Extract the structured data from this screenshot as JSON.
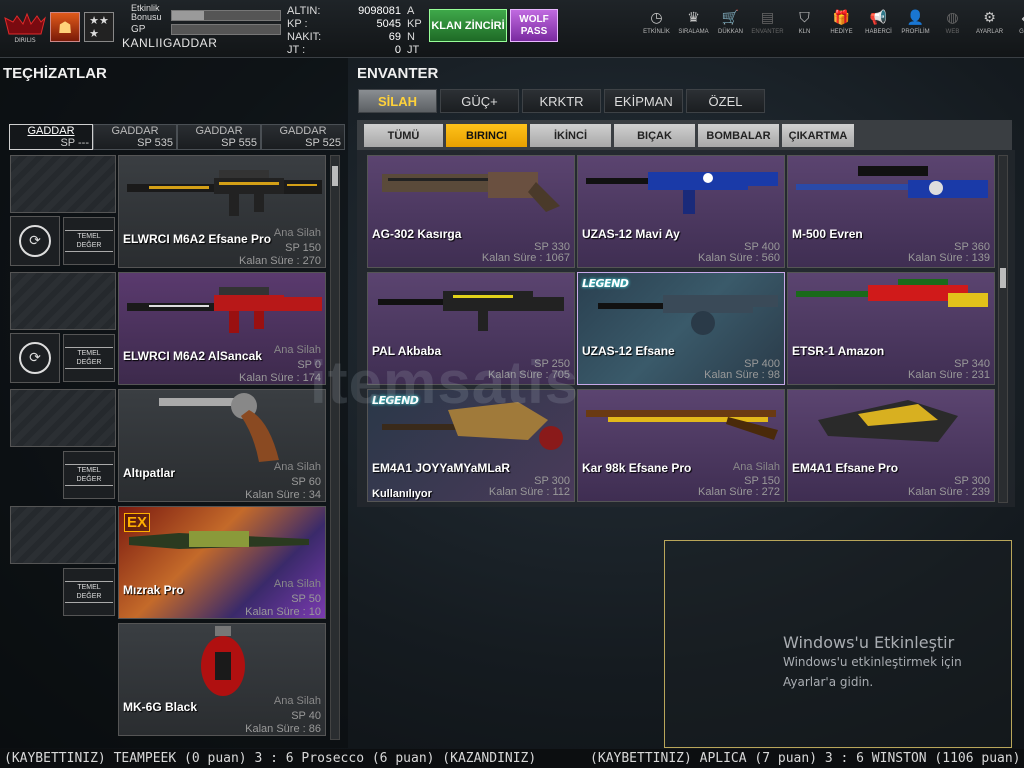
{
  "top": {
    "bonus_label": "Etkinlik Bonusu",
    "bonus_progress": 0.3,
    "gp_label": "GP",
    "gp_progress": 0.0,
    "player_name": "KANLIIGADDAR",
    "logo_text": "DIRILIS",
    "currencies": [
      {
        "label": "ALTIN:",
        "value": "9098081",
        "unit": "A"
      },
      {
        "label": "KP  :",
        "value": "5045",
        "unit": "KP"
      },
      {
        "label": "NAKIT:",
        "value": "69",
        "unit": "N"
      },
      {
        "label": "JT   :",
        "value": "0",
        "unit": "JT"
      }
    ],
    "klan_button": "KLAN ZİNCİRİ",
    "wolf_button_line1": "WOLF",
    "wolf_button_line2": "PASS",
    "nav": [
      {
        "label": "ETKİNLİK",
        "icon": "clock-icon",
        "glyph": "◷"
      },
      {
        "label": "SIRALAMA",
        "icon": "trophy-icon",
        "glyph": "♛"
      },
      {
        "label": "DÜKKAN",
        "icon": "cart-icon",
        "glyph": "🛒"
      },
      {
        "label": "ENVANTER",
        "icon": "inventory-icon",
        "glyph": "▤"
      },
      {
        "label": "KLN",
        "icon": "shield-icon",
        "glyph": "⛉"
      },
      {
        "label": "HEDİYE",
        "icon": "gift-icon",
        "glyph": "🎁"
      },
      {
        "label": "HABERCİ",
        "icon": "megaphone-icon",
        "glyph": "📢"
      },
      {
        "label": "PROFİLİM",
        "icon": "profile-icon",
        "glyph": "👤"
      },
      {
        "label": "WEB",
        "icon": "globe-icon",
        "glyph": "◍"
      },
      {
        "label": "AYARLAR",
        "icon": "gear-icon",
        "glyph": "⚙"
      },
      {
        "label": "GERİ",
        "icon": "back-icon",
        "glyph": "«"
      }
    ]
  },
  "left": {
    "title": "TEÇHİZATLAR",
    "sp_tabs": [
      {
        "name": "GADDAR",
        "sp": "SP ---"
      },
      {
        "name": "GADDAR",
        "sp": "SP 535"
      },
      {
        "name": "GADDAR",
        "sp": "SP 555"
      },
      {
        "name": "GADDAR",
        "sp": "SP 525"
      }
    ],
    "temel_line1": "TEMEL",
    "temel_line2": "DEĞER",
    "equipped": [
      {
        "name": "ELWRCI M6A2 Efsane Pro",
        "type": "Ana Silah",
        "sp": "SP 150",
        "time": "Kalan Süre : 270"
      },
      {
        "name": "ELWRCI M6A2 AlSancak",
        "type": "Ana Silah",
        "sp": "SP 0",
        "time": "Kalan Süre : 174"
      },
      {
        "name": "Altıpatlar",
        "type": "Ana Silah",
        "sp": "SP 60",
        "time": "Kalan Süre : 34"
      },
      {
        "name": "Mızrak Pro",
        "type": "Ana Silah",
        "sp": "SP 50",
        "time": "Kalan Süre : 10",
        "badge": "EX"
      },
      {
        "name": "MK-6G Black",
        "type": "Ana Silah",
        "sp": "SP 40",
        "time": "Kalan Süre : 86"
      }
    ]
  },
  "right": {
    "title": "ENVANTER",
    "cat_tabs": [
      "SİLAH",
      "GÜÇ+",
      "KRKTR",
      "EKİPMAN",
      "ÖZEL"
    ],
    "sub_tabs": [
      "TÜMÜ",
      "BIRINCI",
      "İKİNCİ",
      "BIÇAK",
      "BOMBALAR",
      "ÇIKARTMA"
    ],
    "items": [
      {
        "name": "AG-302 Kasırga",
        "sp": "SP 330",
        "time": "Kalan Süre : 1067"
      },
      {
        "name": "UZAS-12 Mavi Ay",
        "sp": "SP 400",
        "time": "Kalan Süre : 560"
      },
      {
        "name": "M-500 Evren",
        "sp": "SP 360",
        "time": "Kalan Süre : 139"
      },
      {
        "name": "PAL Akbaba",
        "sp": "SP 250",
        "time": "Kalan Süre : 705"
      },
      {
        "name": "UZAS-12 Efsane",
        "sp": "SP 400",
        "time": "Kalan Süre : 98",
        "legend": "LEGEND"
      },
      {
        "name": "ETSR-1 Amazon",
        "sp": "SP 340",
        "time": "Kalan Süre : 231"
      },
      {
        "name": "EM4A1 JOYYaMYaMLaR",
        "sp": "SP 300",
        "time": "Kalan Süre : 112",
        "legend": "LEGEND",
        "status": "Kullanılıyor"
      },
      {
        "name": "Kar 98k Efsane Pro",
        "type": "Ana Silah",
        "sp": "SP 150",
        "time": "Kalan Süre : 272"
      },
      {
        "name": "EM4A1 Efsane Pro",
        "sp": "SP 300",
        "time": "Kalan Süre : 239"
      }
    ]
  },
  "watermark": "itemsatis",
  "windows": {
    "heading": "Windows'u Etkinleştir",
    "line1": "Windows'u etkinleştirmek için",
    "line2": "Ayarlar'a gidin."
  },
  "ticker": [
    "(KAYBETTINIZ) TEAMPEEK (0 puan) 3 : 6 Prosecco (6 puan) (KAZANDINIZ)",
    "(KAYBETTINIZ) APLICA (7 puan) 3 : 6 WINSTON (1106 puan) (KAZANDINIZ)"
  ]
}
